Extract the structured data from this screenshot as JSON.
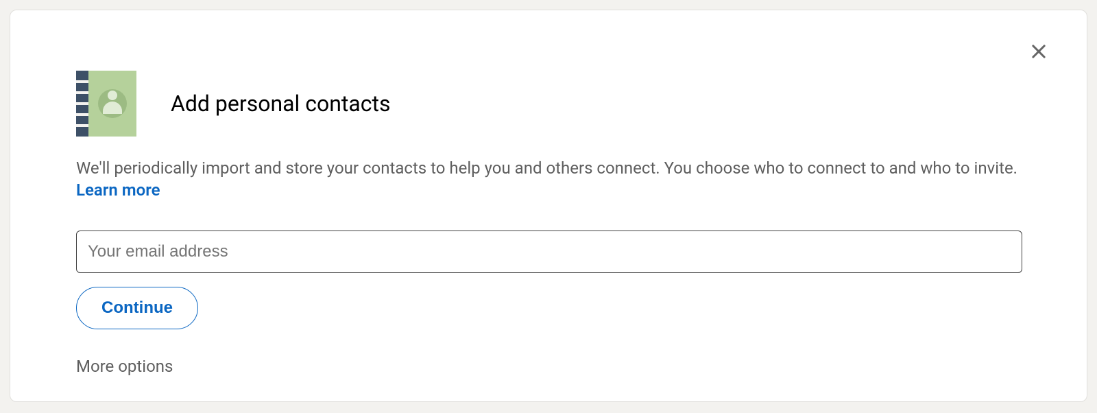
{
  "modal": {
    "title": "Add personal contacts",
    "description_prefix": "We'll periodically import and store your contacts to help you and others connect. You choose who to connect to and who to invite. ",
    "learn_more": "Learn more",
    "email_placeholder": "Your email address",
    "email_value": "",
    "continue_label": "Continue",
    "more_options_label": "More options"
  }
}
